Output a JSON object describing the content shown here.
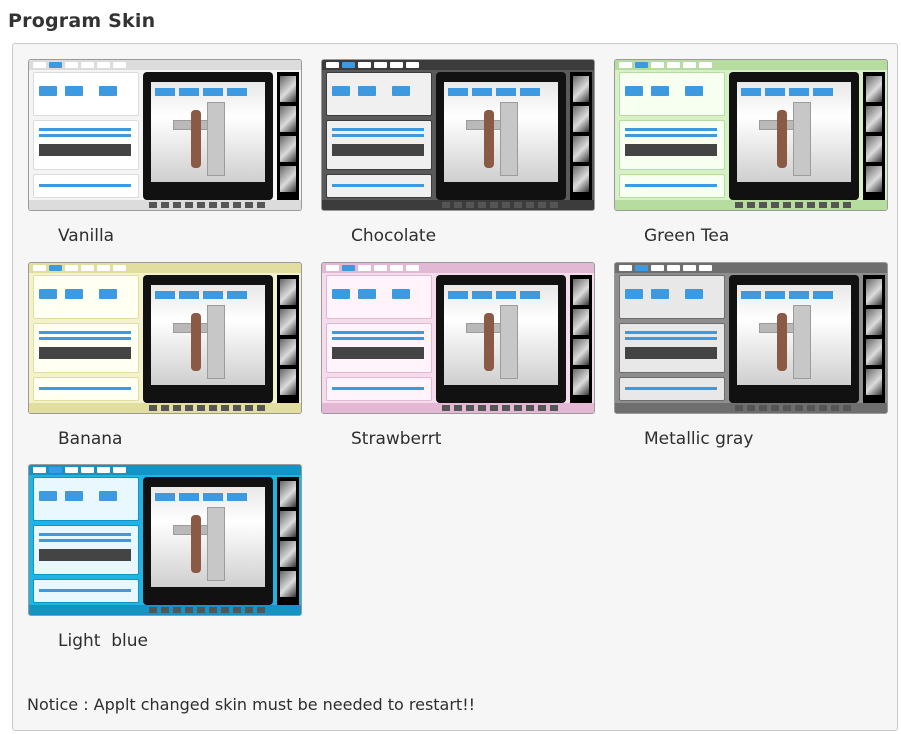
{
  "section": {
    "title": "Program Skin"
  },
  "skins": [
    {
      "label": "Vanilla",
      "bg": "#f4f4f4",
      "frame": "#dcdcdc",
      "card": "#ffffff",
      "accent": "#3e9ae0"
    },
    {
      "label": "Chocolate",
      "bg": "#5a5a5a",
      "frame": "#3c3c3c",
      "card": "#f0f0f0",
      "accent": "#3e9ae0"
    },
    {
      "label": "Green Tea",
      "bg": "#d8f0c8",
      "frame": "#b6dca0",
      "card": "#f6fff0",
      "accent": "#3e9ae0"
    },
    {
      "label": "Banana",
      "bg": "#f4f2cc",
      "frame": "#e2dea0",
      "card": "#fffff2",
      "accent": "#3e9ae0"
    },
    {
      "label": "Strawberrt",
      "bg": "#f4dceb",
      "frame": "#e2b8d4",
      "card": "#fff4fb",
      "accent": "#3e9ae0"
    },
    {
      "label": "Metallic gray",
      "bg": "#8e8e8e",
      "frame": "#6e6e6e",
      "card": "#e8e8e8",
      "accent": "#3e9ae0"
    },
    {
      "label": "Light  blue",
      "bg": "#1fb4e4",
      "frame": "#1394c4",
      "card": "#e9f8ff",
      "accent": "#3e9ae0"
    }
  ],
  "notice": {
    "text": "Notice : Applt changed skin must be needed to restart!!"
  }
}
